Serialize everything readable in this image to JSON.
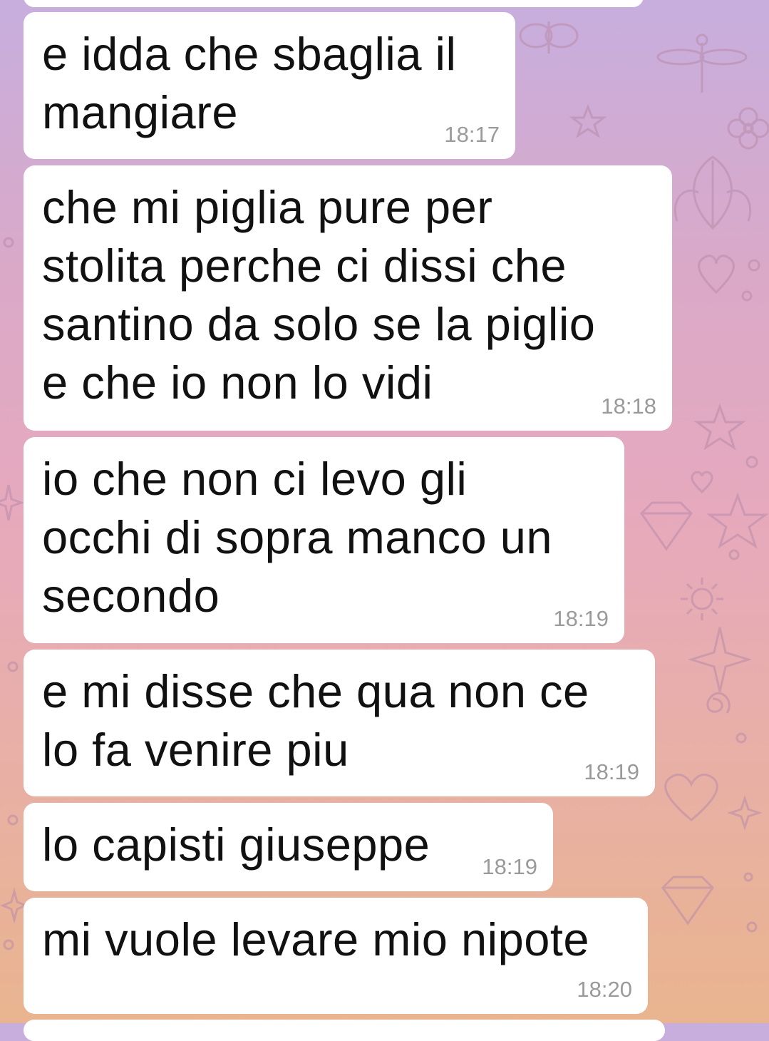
{
  "chat": {
    "messages": [
      {
        "text": "e idda che sbaglia il\nmangiare",
        "time": "18:17"
      },
      {
        "text": "che mi piglia pure per\nstolita perche ci dissi che\nsantino da solo se la piglio\ne che io non lo vidi",
        "time": "18:18"
      },
      {
        "text": "io che non ci levo gli\nocchi di sopra manco un\nsecondo",
        "time": "18:19"
      },
      {
        "text": "e mi disse che qua non ce\nlo fa venire piu",
        "time": "18:19"
      },
      {
        "text": "lo capisti giuseppe",
        "time": "18:19"
      },
      {
        "text": "mi vuole levare mio nipote",
        "time": "18:20"
      }
    ]
  },
  "colors": {
    "bubble": "#ffffff",
    "text": "#111111",
    "timestamp": "#9a9a9a",
    "wallpaper_top": "#c7aede",
    "wallpaper_bottom": "#e9b48f",
    "doodle": "#b98aa8"
  },
  "wallpaper": {
    "icons": [
      "butterfly-icon",
      "dragonfly-icon",
      "flower-icon",
      "star-icon",
      "heart-icon",
      "diamond-icon",
      "sun-icon",
      "leaf-icon",
      "sparkle-icon",
      "spiral-icon"
    ]
  }
}
